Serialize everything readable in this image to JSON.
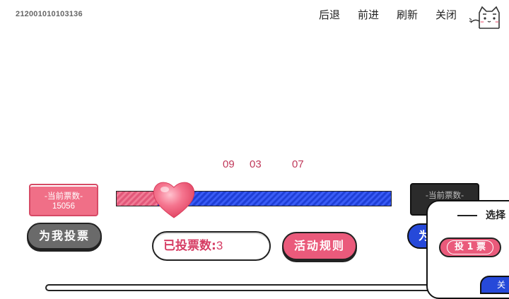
{
  "header": {
    "page_id": "212001010103136",
    "nav": {
      "back": "后退",
      "forward": "前进",
      "refresh": "刷新",
      "close": "关闭"
    }
  },
  "countdown": {
    "d1": "09",
    "d2": "03",
    "d3": "07"
  },
  "left_candidate": {
    "label": "-当前票数-",
    "votes": "15056"
  },
  "right_candidate": {
    "label": "-当前票数-"
  },
  "buttons": {
    "vote_for_me": "为我投票",
    "rules": "活动规则",
    "right_vote_partial": "为"
  },
  "voted": {
    "label": "已投票数:",
    "count": "3"
  },
  "vote_popup": {
    "title": "选择",
    "vote_one": "投 1 票",
    "bottom_partial": "关"
  },
  "colors": {
    "pink": "#ea5a7b",
    "blue": "#2649d9",
    "dark": "#2b2b2b"
  },
  "icons": {
    "mascot": "cat-mascot-icon",
    "heart": "heart-icon"
  }
}
